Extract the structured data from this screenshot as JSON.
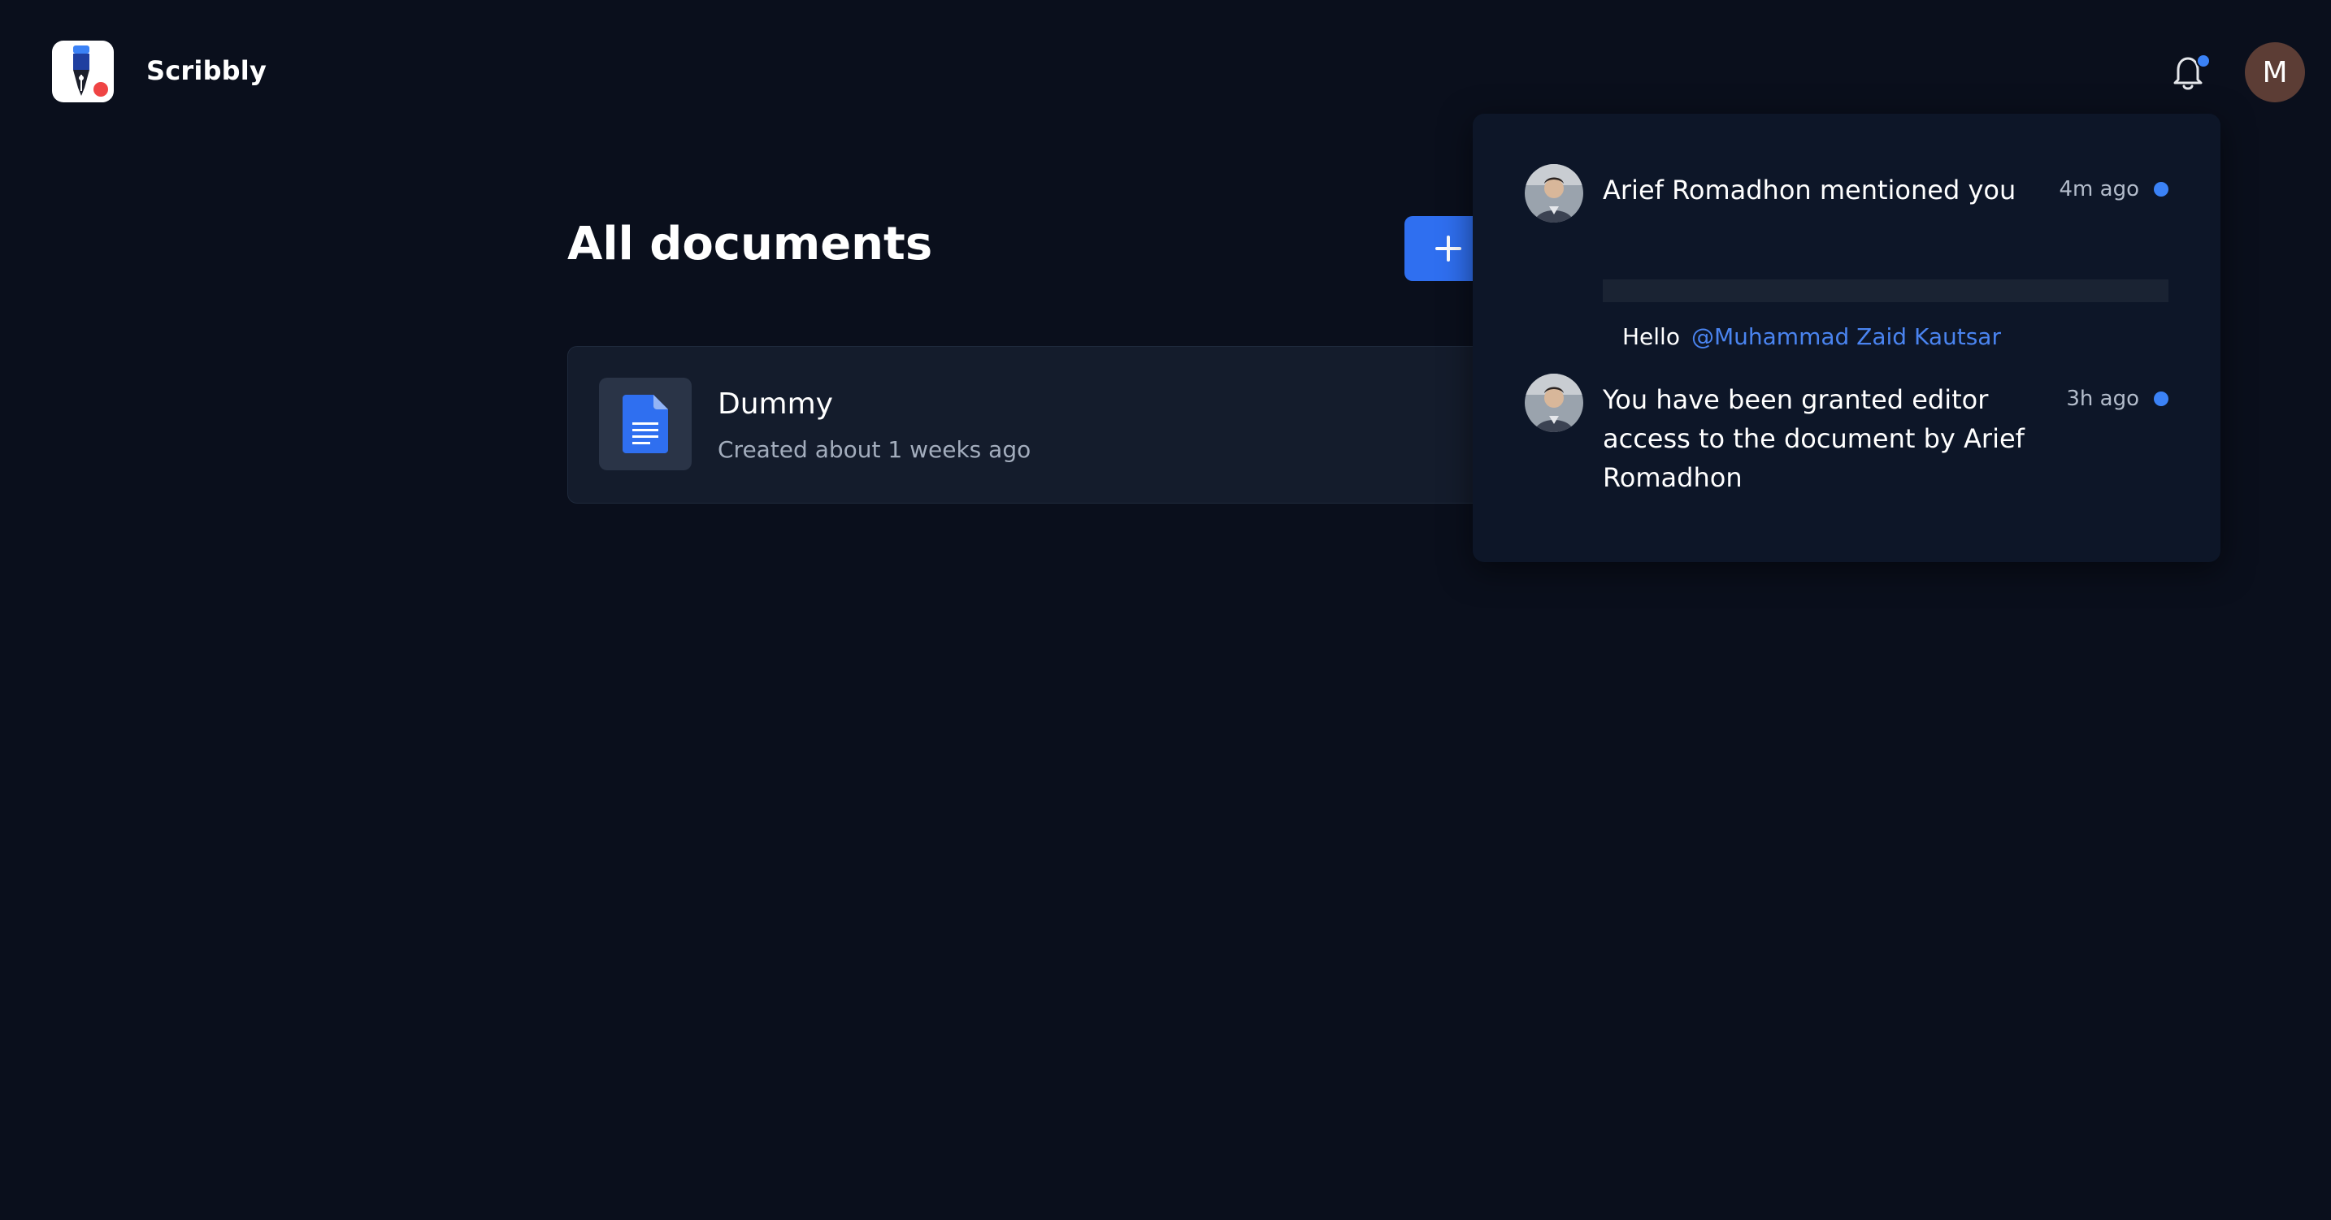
{
  "header": {
    "brand": "Scribbly",
    "avatar_initial": "M",
    "icons": {
      "logo": "scribbly-pen-logo",
      "notifications": "bell-icon"
    }
  },
  "main": {
    "title": "All documents",
    "new_button_icon": "plus-icon",
    "documents": [
      {
        "name": "Dummy",
        "meta": "Created about 1 weeks ago",
        "icon": "document-icon"
      }
    ]
  },
  "notifications": [
    {
      "author": "Arief Romadhon",
      "action": " mentioned you",
      "time": "4m ago",
      "quote_prefix": "Hello",
      "mention": "@Muhammad Zaid Kautsar",
      "unread": true
    },
    {
      "text": "You have been granted editor access to the document by Arief Romadhon",
      "time": "3h ago",
      "unread": true
    }
  ],
  "colors": {
    "background": "#0a0f1c",
    "accent": "#2f6ff0",
    "unread": "#3b82f6",
    "mention": "#4a84f0",
    "avatar": "#5c3d35"
  }
}
